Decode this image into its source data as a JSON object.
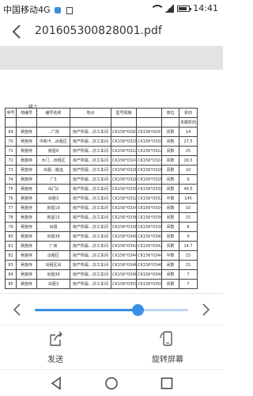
{
  "status_bar": {
    "carrier": "中国移动4G",
    "time": "14:41",
    "battery_level": 0.8
  },
  "header": {
    "title": "201605300828001.pdf"
  },
  "document": {
    "top_label": "续上",
    "columns_row1": [
      "序号",
      "地编号",
      "编号名称",
      "地点",
      "",
      "型号规格",
      "",
      "单位",
      "",
      "折旧"
    ],
    "columns_row2": [
      "",
      "",
      "",
      "",
      "",
      "",
      "",
      "",
      "",
      "本期折旧"
    ],
    "rows": [
      [
        "69",
        "吴施存",
        "…厂房",
        "房产所属…办工车间",
        "CK156*0293",
        "CK156*0293",
        "间数",
        "14"
      ],
      [
        "70",
        "吴施存",
        "中和卡…出租区",
        "房产所属…办工车间",
        "CK156*0320",
        "CK156*0320",
        "间数",
        "27.5"
      ],
      [
        "71",
        "吴施存",
        "房屋9",
        "房产所属…办工车间",
        "CK156*0322",
        "CK156*0322",
        "间数",
        "25"
      ],
      [
        "72",
        "吴施存",
        "木门…出租区",
        "房产所属…办工车间",
        "CK156*0324",
        "CK156*0324",
        "间数",
        "16.5"
      ],
      [
        "73",
        "吴施存",
        "出租…搬运",
        "房产所属…办工车间",
        "CK156*0326",
        "CK156*0326",
        "间数",
        "10"
      ],
      [
        "74",
        "吴施存",
        "厂3",
        "房产所属…办工车间",
        "CK156*0328",
        "CK156*0328",
        "间数",
        "9"
      ],
      [
        "75",
        "吴施存",
        "出门2",
        "房产所属…办工车间",
        "CK156*0330",
        "CK156*0330",
        "间数",
        "49.5"
      ],
      [
        "76",
        "吴施存",
        "出租3",
        "房产所属…办工车间",
        "CK156*0332",
        "CK156*0332",
        "平数",
        "145"
      ],
      [
        "77",
        "吴施存",
        "房屋19",
        "房产所属…办工车间",
        "CK156*0334",
        "CK156*0334",
        "间数",
        "10"
      ],
      [
        "78",
        "吴施存",
        "房屋15",
        "房产所属…办工车间",
        "CK156*0336",
        "CK156*0336",
        "间数",
        "15"
      ],
      [
        "79",
        "吴施存",
        "出租",
        "房产所属…办工车间",
        "CK156*0338",
        "CK156*0338",
        "间数",
        "8"
      ],
      [
        "80",
        "吴施存",
        "出租36",
        "房产所属…办工车间",
        "CK156*0340",
        "CK156*0340",
        "间数",
        "9"
      ],
      [
        "81",
        "吴施存",
        "厂房",
        "房产所属…办工车间",
        "CK156*0342",
        "CK156*0342",
        "间数",
        "14.7"
      ],
      [
        "82",
        "吴施存",
        "出租区",
        "房产所属…办工车间",
        "CK156*0344",
        "CK156*0344",
        "平数",
        "15"
      ],
      [
        "83",
        "吴施存",
        "出租区出",
        "房产所属…办工车间",
        "CK156*0346",
        "CK156*0346",
        "间数",
        "15"
      ],
      [
        "84",
        "吴施存",
        "出租36",
        "房产所属…办工车间",
        "CK156*0348",
        "CK156*0348",
        "间数",
        "7"
      ],
      [
        "85",
        "吴施存",
        "出租3",
        "房产所属…办工车间",
        "CK156*0350",
        "CK156*0350",
        "间数",
        "7"
      ]
    ]
  },
  "pager": {
    "progress": 0.67
  },
  "actions": {
    "share_label": "发送",
    "rotate_label": "旋转屏幕"
  },
  "colors": {
    "accent": "#3a8ee6",
    "band": "#e3e3e3"
  }
}
